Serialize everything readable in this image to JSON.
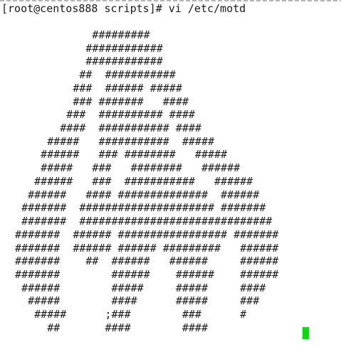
{
  "terminal": {
    "prompt": "[root@centos888 scripts]# vi /etc/motd",
    "cursor_color": "#00e000",
    "background_color": "#ffffff",
    "text_color": "#1a1a1a"
  },
  "motd_lines": [
    "              #########",
    "             ############",
    "             ############",
    "            ##  ###########",
    "           ###  ###### #####",
    "           ### #######   ####",
    "          ###  ########## ####",
    "         ####  ########### ####",
    "       #####   ###########  #####",
    "      ######   ### ########   #####",
    "      #####   ###   ########   ######",
    "     ######   ###  ###########   ######",
    "    ######   #### ##############  ######",
    "   #######  ##################### #######",
    "   #######  ##############################",
    "  #######  ###### ################# #######",
    "  #######  ###### ###### #########   ######",
    "  #######    ##  ######   ######     ######",
    "  #######        ######    ######    ######",
    "   ######        #####     #####     ####",
    "    #####        ####      #####     ###",
    "     #####      ;###        ###      #",
    "       ##       ####        ####"
  ]
}
